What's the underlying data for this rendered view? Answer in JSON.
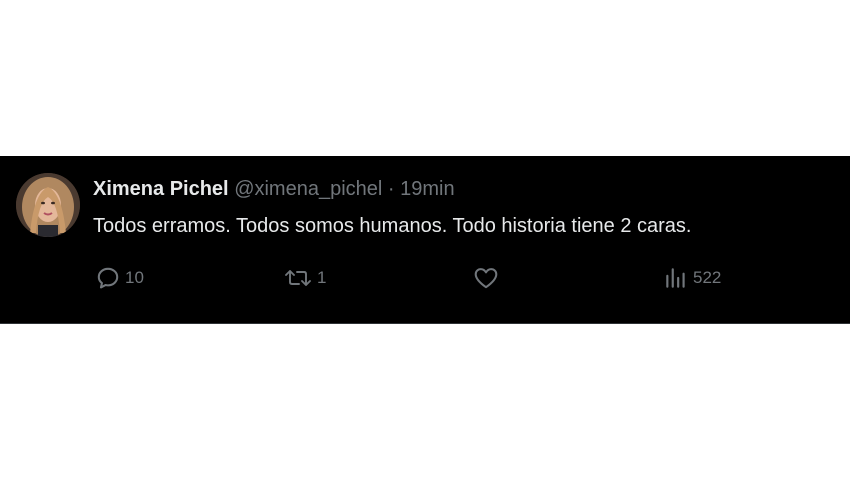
{
  "tweet": {
    "author_name": "Ximena Pichel",
    "author_handle": "@ximena_pichel",
    "separator": "·",
    "time": "19min",
    "text": "Todos erramos. Todos somos humanos. Todo historia tiene 2 caras.",
    "actions": {
      "reply": {
        "icon": "reply-icon",
        "count": "10"
      },
      "retweet": {
        "icon": "retweet-icon",
        "count": "1"
      },
      "like": {
        "icon": "heart-icon",
        "count": ""
      },
      "views": {
        "icon": "views-icon",
        "count": "522"
      }
    }
  },
  "colors": {
    "background": "#000000",
    "text_primary": "#e7e9ea",
    "text_secondary": "#71767b",
    "divider": "#2f3336"
  }
}
